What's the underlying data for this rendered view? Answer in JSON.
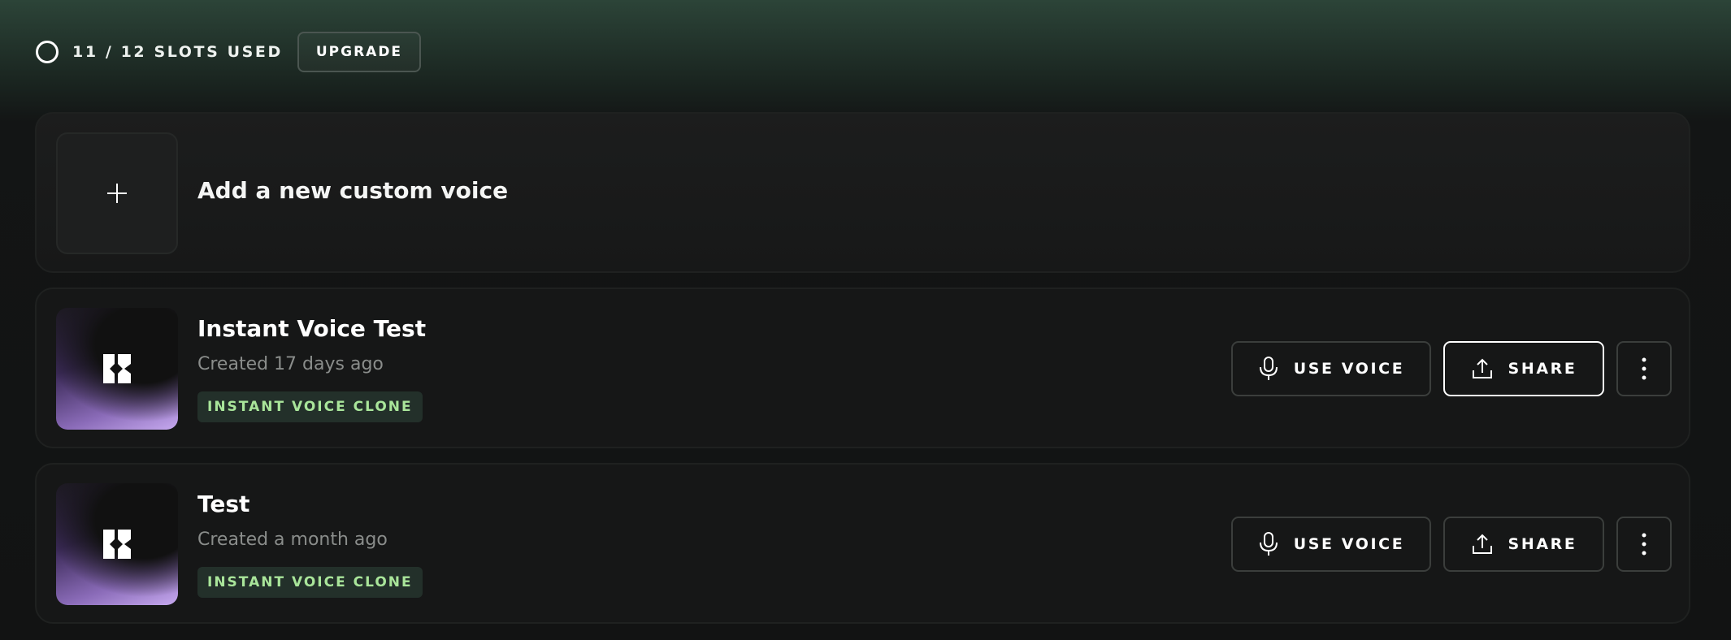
{
  "header": {
    "slots_label": "11 / 12 SLOTS USED",
    "slots_used": 11,
    "slots_total": 12,
    "upgrade_label": "UPGRADE",
    "ring_icon": "progress-ring-icon"
  },
  "add_card": {
    "label": "Add a new custom voice",
    "icon": "plus-icon"
  },
  "voices": [
    {
      "name": "Instant Voice Test",
      "created": "Created 17 days ago",
      "badge": "INSTANT VOICE CLONE",
      "use_label": "USE VOICE",
      "share_label": "SHARE",
      "share_focused": true
    },
    {
      "name": "Test",
      "created": "Created a month ago",
      "badge": "INSTANT VOICE CLONE",
      "use_label": "USE VOICE",
      "share_label": "SHARE",
      "share_focused": false
    }
  ],
  "icons": {
    "thumbnail": "voice-logo-icon",
    "use": "microphone-icon",
    "share": "upload-icon",
    "more": "more-vertical-icon"
  },
  "colors": {
    "header_green": "#2c4438",
    "badge_bg": "#23302a",
    "badge_text": "#a9e59a",
    "thumb_purple": "#c6a9ef"
  }
}
